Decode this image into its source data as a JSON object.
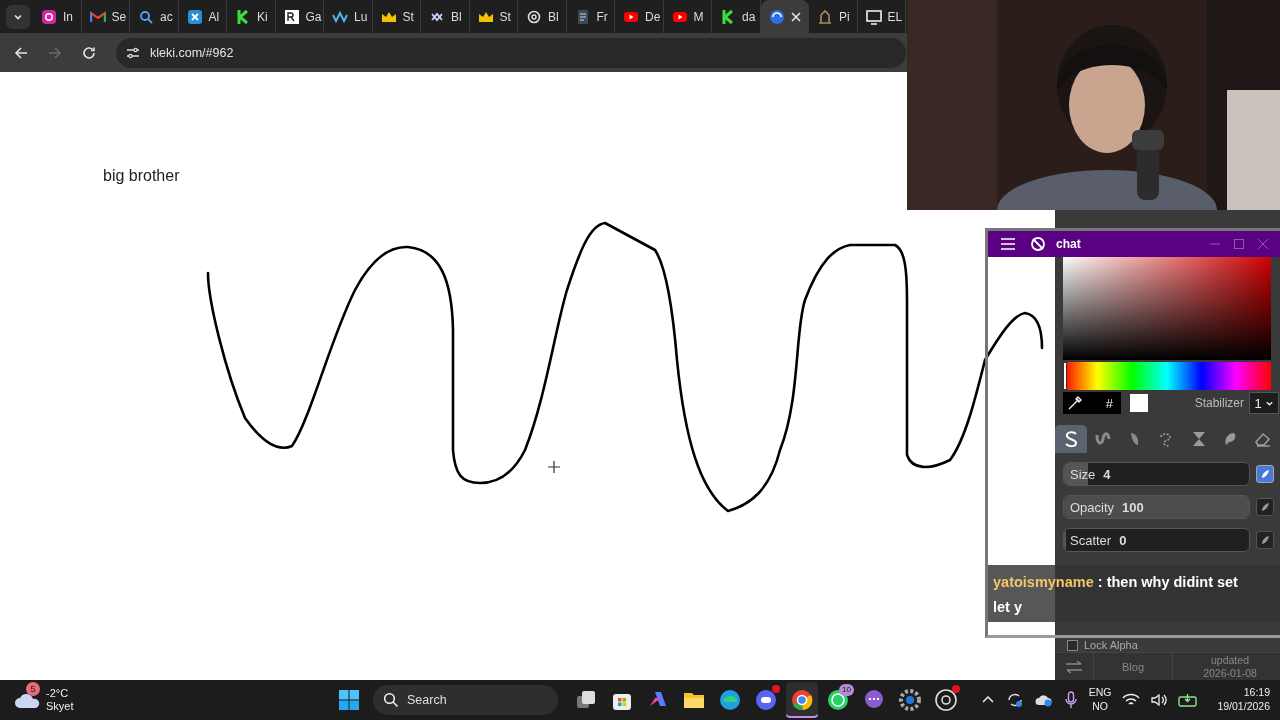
{
  "browser": {
    "tabs": [
      {
        "kind": "camera",
        "label": "In",
        "selected": false
      },
      {
        "kind": "mail",
        "label": "Se",
        "selected": false
      },
      {
        "kind": "search",
        "label": "ac",
        "selected": false
      },
      {
        "kind": "cross",
        "label": "Al",
        "selected": false
      },
      {
        "kind": "k",
        "label": "Ki",
        "selected": false
      },
      {
        "kind": "square",
        "label": "Ga",
        "selected": false
      },
      {
        "kind": "wave",
        "label": "Lu",
        "selected": false
      },
      {
        "kind": "crown",
        "label": "St",
        "selected": false
      },
      {
        "kind": "knot",
        "label": "Bl",
        "selected": false
      },
      {
        "kind": "crown",
        "label": "St",
        "selected": false
      },
      {
        "kind": "flower",
        "label": "Bl",
        "selected": false
      },
      {
        "kind": "document",
        "label": "Fr",
        "selected": false
      },
      {
        "kind": "play",
        "label": "De",
        "selected": false
      },
      {
        "kind": "play",
        "label": "M",
        "selected": false
      },
      {
        "kind": "k",
        "label": "da",
        "selected": false
      },
      {
        "kind": "globe",
        "selected": true
      },
      {
        "kind": "building",
        "label": "Pi",
        "selected": false
      },
      {
        "kind": "monitor",
        "label": "EL",
        "selected": false
      }
    ],
    "forward_disabled": true,
    "address": "kleki.com/#962"
  },
  "canvas": {
    "text": "big brother"
  },
  "kleki_panel": {
    "hue": {
      "level": 0
    },
    "hex_label": "#",
    "stabilizer_label": "Stabilizer",
    "stabilizer_value": "1",
    "tools": [
      {
        "kind": "pen",
        "selected": true
      },
      {
        "kind": "blend",
        "selected": false
      },
      {
        "kind": "smudge",
        "selected": false
      },
      {
        "kind": "lasso",
        "selected": false
      },
      {
        "kind": "gradient",
        "selected": false
      },
      {
        "kind": "fill",
        "selected": false
      },
      {
        "kind": "eraser",
        "selected": false
      }
    ],
    "sliders": [
      {
        "label": "Size",
        "value": "4",
        "level": 0.13,
        "pressure": true
      },
      {
        "label": "Opacity",
        "value": "100",
        "level": 1,
        "pressure": false
      },
      {
        "label": "Scatter",
        "value": "0",
        "level": 0,
        "pressure": false
      }
    ],
    "lock_alpha": {
      "label": "Lock Alpha",
      "checked": false
    },
    "footer": {
      "blog": "Blog",
      "updated_label": "updated",
      "updated_date": "2026-01-08"
    }
  },
  "chat_window": {
    "title": "chat",
    "message": {
      "user": "yatoismyname",
      "text": ": then why didint set",
      "continuation": "let y"
    }
  },
  "taskbar": {
    "weather": {
      "badge": "5",
      "temperature": "-2°C",
      "condition": "Skyet"
    },
    "search_placeholder": "Search",
    "apps": [
      {
        "kind": "taskview",
        "active": false
      },
      {
        "kind": "store",
        "active": false
      },
      {
        "kind": "copilot",
        "active": false
      },
      {
        "kind": "folder",
        "active": false
      },
      {
        "kind": "edge",
        "active": false
      },
      {
        "kind": "discord",
        "active": false,
        "dot": true
      },
      {
        "kind": "chrome",
        "active": true
      },
      {
        "kind": "whatsapp",
        "active": false,
        "badge": "10"
      },
      {
        "kind": "bubble",
        "active": false
      },
      {
        "kind": "gear",
        "active": false
      },
      {
        "kind": "obs",
        "active": false,
        "dot": true
      }
    ],
    "tray": {
      "language": "ENG",
      "layout": "NO",
      "time": "16:19",
      "date": "19/01/2026"
    }
  }
}
